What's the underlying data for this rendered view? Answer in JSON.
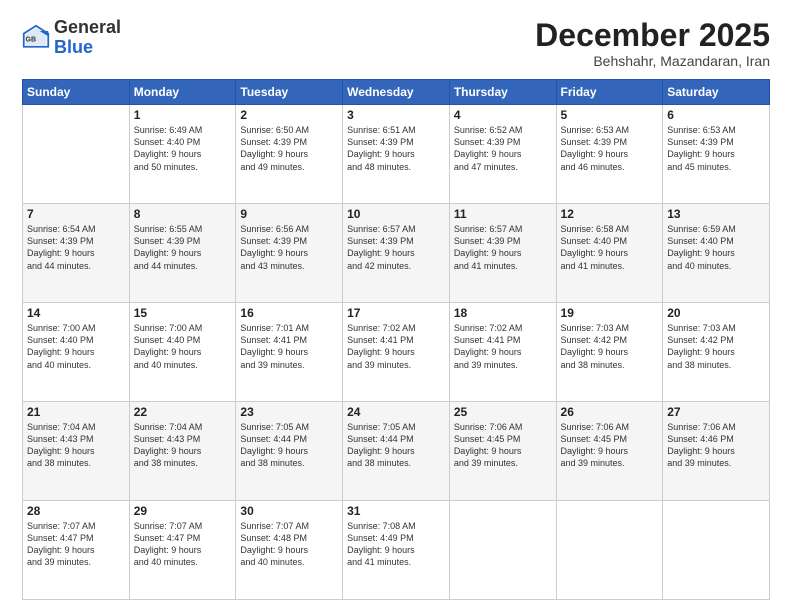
{
  "logo": {
    "general": "General",
    "blue": "Blue"
  },
  "header": {
    "month": "December 2025",
    "location": "Behshahr, Mazandaran, Iran"
  },
  "weekdays": [
    "Sunday",
    "Monday",
    "Tuesday",
    "Wednesday",
    "Thursday",
    "Friday",
    "Saturday"
  ],
  "weeks": [
    [
      {
        "day": "",
        "info": ""
      },
      {
        "day": "1",
        "info": "Sunrise: 6:49 AM\nSunset: 4:40 PM\nDaylight: 9 hours\nand 50 minutes."
      },
      {
        "day": "2",
        "info": "Sunrise: 6:50 AM\nSunset: 4:39 PM\nDaylight: 9 hours\nand 49 minutes."
      },
      {
        "day": "3",
        "info": "Sunrise: 6:51 AM\nSunset: 4:39 PM\nDaylight: 9 hours\nand 48 minutes."
      },
      {
        "day": "4",
        "info": "Sunrise: 6:52 AM\nSunset: 4:39 PM\nDaylight: 9 hours\nand 47 minutes."
      },
      {
        "day": "5",
        "info": "Sunrise: 6:53 AM\nSunset: 4:39 PM\nDaylight: 9 hours\nand 46 minutes."
      },
      {
        "day": "6",
        "info": "Sunrise: 6:53 AM\nSunset: 4:39 PM\nDaylight: 9 hours\nand 45 minutes."
      }
    ],
    [
      {
        "day": "7",
        "info": "Sunrise: 6:54 AM\nSunset: 4:39 PM\nDaylight: 9 hours\nand 44 minutes."
      },
      {
        "day": "8",
        "info": "Sunrise: 6:55 AM\nSunset: 4:39 PM\nDaylight: 9 hours\nand 44 minutes."
      },
      {
        "day": "9",
        "info": "Sunrise: 6:56 AM\nSunset: 4:39 PM\nDaylight: 9 hours\nand 43 minutes."
      },
      {
        "day": "10",
        "info": "Sunrise: 6:57 AM\nSunset: 4:39 PM\nDaylight: 9 hours\nand 42 minutes."
      },
      {
        "day": "11",
        "info": "Sunrise: 6:57 AM\nSunset: 4:39 PM\nDaylight: 9 hours\nand 41 minutes."
      },
      {
        "day": "12",
        "info": "Sunrise: 6:58 AM\nSunset: 4:40 PM\nDaylight: 9 hours\nand 41 minutes."
      },
      {
        "day": "13",
        "info": "Sunrise: 6:59 AM\nSunset: 4:40 PM\nDaylight: 9 hours\nand 40 minutes."
      }
    ],
    [
      {
        "day": "14",
        "info": "Sunrise: 7:00 AM\nSunset: 4:40 PM\nDaylight: 9 hours\nand 40 minutes."
      },
      {
        "day": "15",
        "info": "Sunrise: 7:00 AM\nSunset: 4:40 PM\nDaylight: 9 hours\nand 40 minutes."
      },
      {
        "day": "16",
        "info": "Sunrise: 7:01 AM\nSunset: 4:41 PM\nDaylight: 9 hours\nand 39 minutes."
      },
      {
        "day": "17",
        "info": "Sunrise: 7:02 AM\nSunset: 4:41 PM\nDaylight: 9 hours\nand 39 minutes."
      },
      {
        "day": "18",
        "info": "Sunrise: 7:02 AM\nSunset: 4:41 PM\nDaylight: 9 hours\nand 39 minutes."
      },
      {
        "day": "19",
        "info": "Sunrise: 7:03 AM\nSunset: 4:42 PM\nDaylight: 9 hours\nand 38 minutes."
      },
      {
        "day": "20",
        "info": "Sunrise: 7:03 AM\nSunset: 4:42 PM\nDaylight: 9 hours\nand 38 minutes."
      }
    ],
    [
      {
        "day": "21",
        "info": "Sunrise: 7:04 AM\nSunset: 4:43 PM\nDaylight: 9 hours\nand 38 minutes."
      },
      {
        "day": "22",
        "info": "Sunrise: 7:04 AM\nSunset: 4:43 PM\nDaylight: 9 hours\nand 38 minutes."
      },
      {
        "day": "23",
        "info": "Sunrise: 7:05 AM\nSunset: 4:44 PM\nDaylight: 9 hours\nand 38 minutes."
      },
      {
        "day": "24",
        "info": "Sunrise: 7:05 AM\nSunset: 4:44 PM\nDaylight: 9 hours\nand 38 minutes."
      },
      {
        "day": "25",
        "info": "Sunrise: 7:06 AM\nSunset: 4:45 PM\nDaylight: 9 hours\nand 39 minutes."
      },
      {
        "day": "26",
        "info": "Sunrise: 7:06 AM\nSunset: 4:45 PM\nDaylight: 9 hours\nand 39 minutes."
      },
      {
        "day": "27",
        "info": "Sunrise: 7:06 AM\nSunset: 4:46 PM\nDaylight: 9 hours\nand 39 minutes."
      }
    ],
    [
      {
        "day": "28",
        "info": "Sunrise: 7:07 AM\nSunset: 4:47 PM\nDaylight: 9 hours\nand 39 minutes."
      },
      {
        "day": "29",
        "info": "Sunrise: 7:07 AM\nSunset: 4:47 PM\nDaylight: 9 hours\nand 40 minutes."
      },
      {
        "day": "30",
        "info": "Sunrise: 7:07 AM\nSunset: 4:48 PM\nDaylight: 9 hours\nand 40 minutes."
      },
      {
        "day": "31",
        "info": "Sunrise: 7:08 AM\nSunset: 4:49 PM\nDaylight: 9 hours\nand 41 minutes."
      },
      {
        "day": "",
        "info": ""
      },
      {
        "day": "",
        "info": ""
      },
      {
        "day": "",
        "info": ""
      }
    ]
  ]
}
